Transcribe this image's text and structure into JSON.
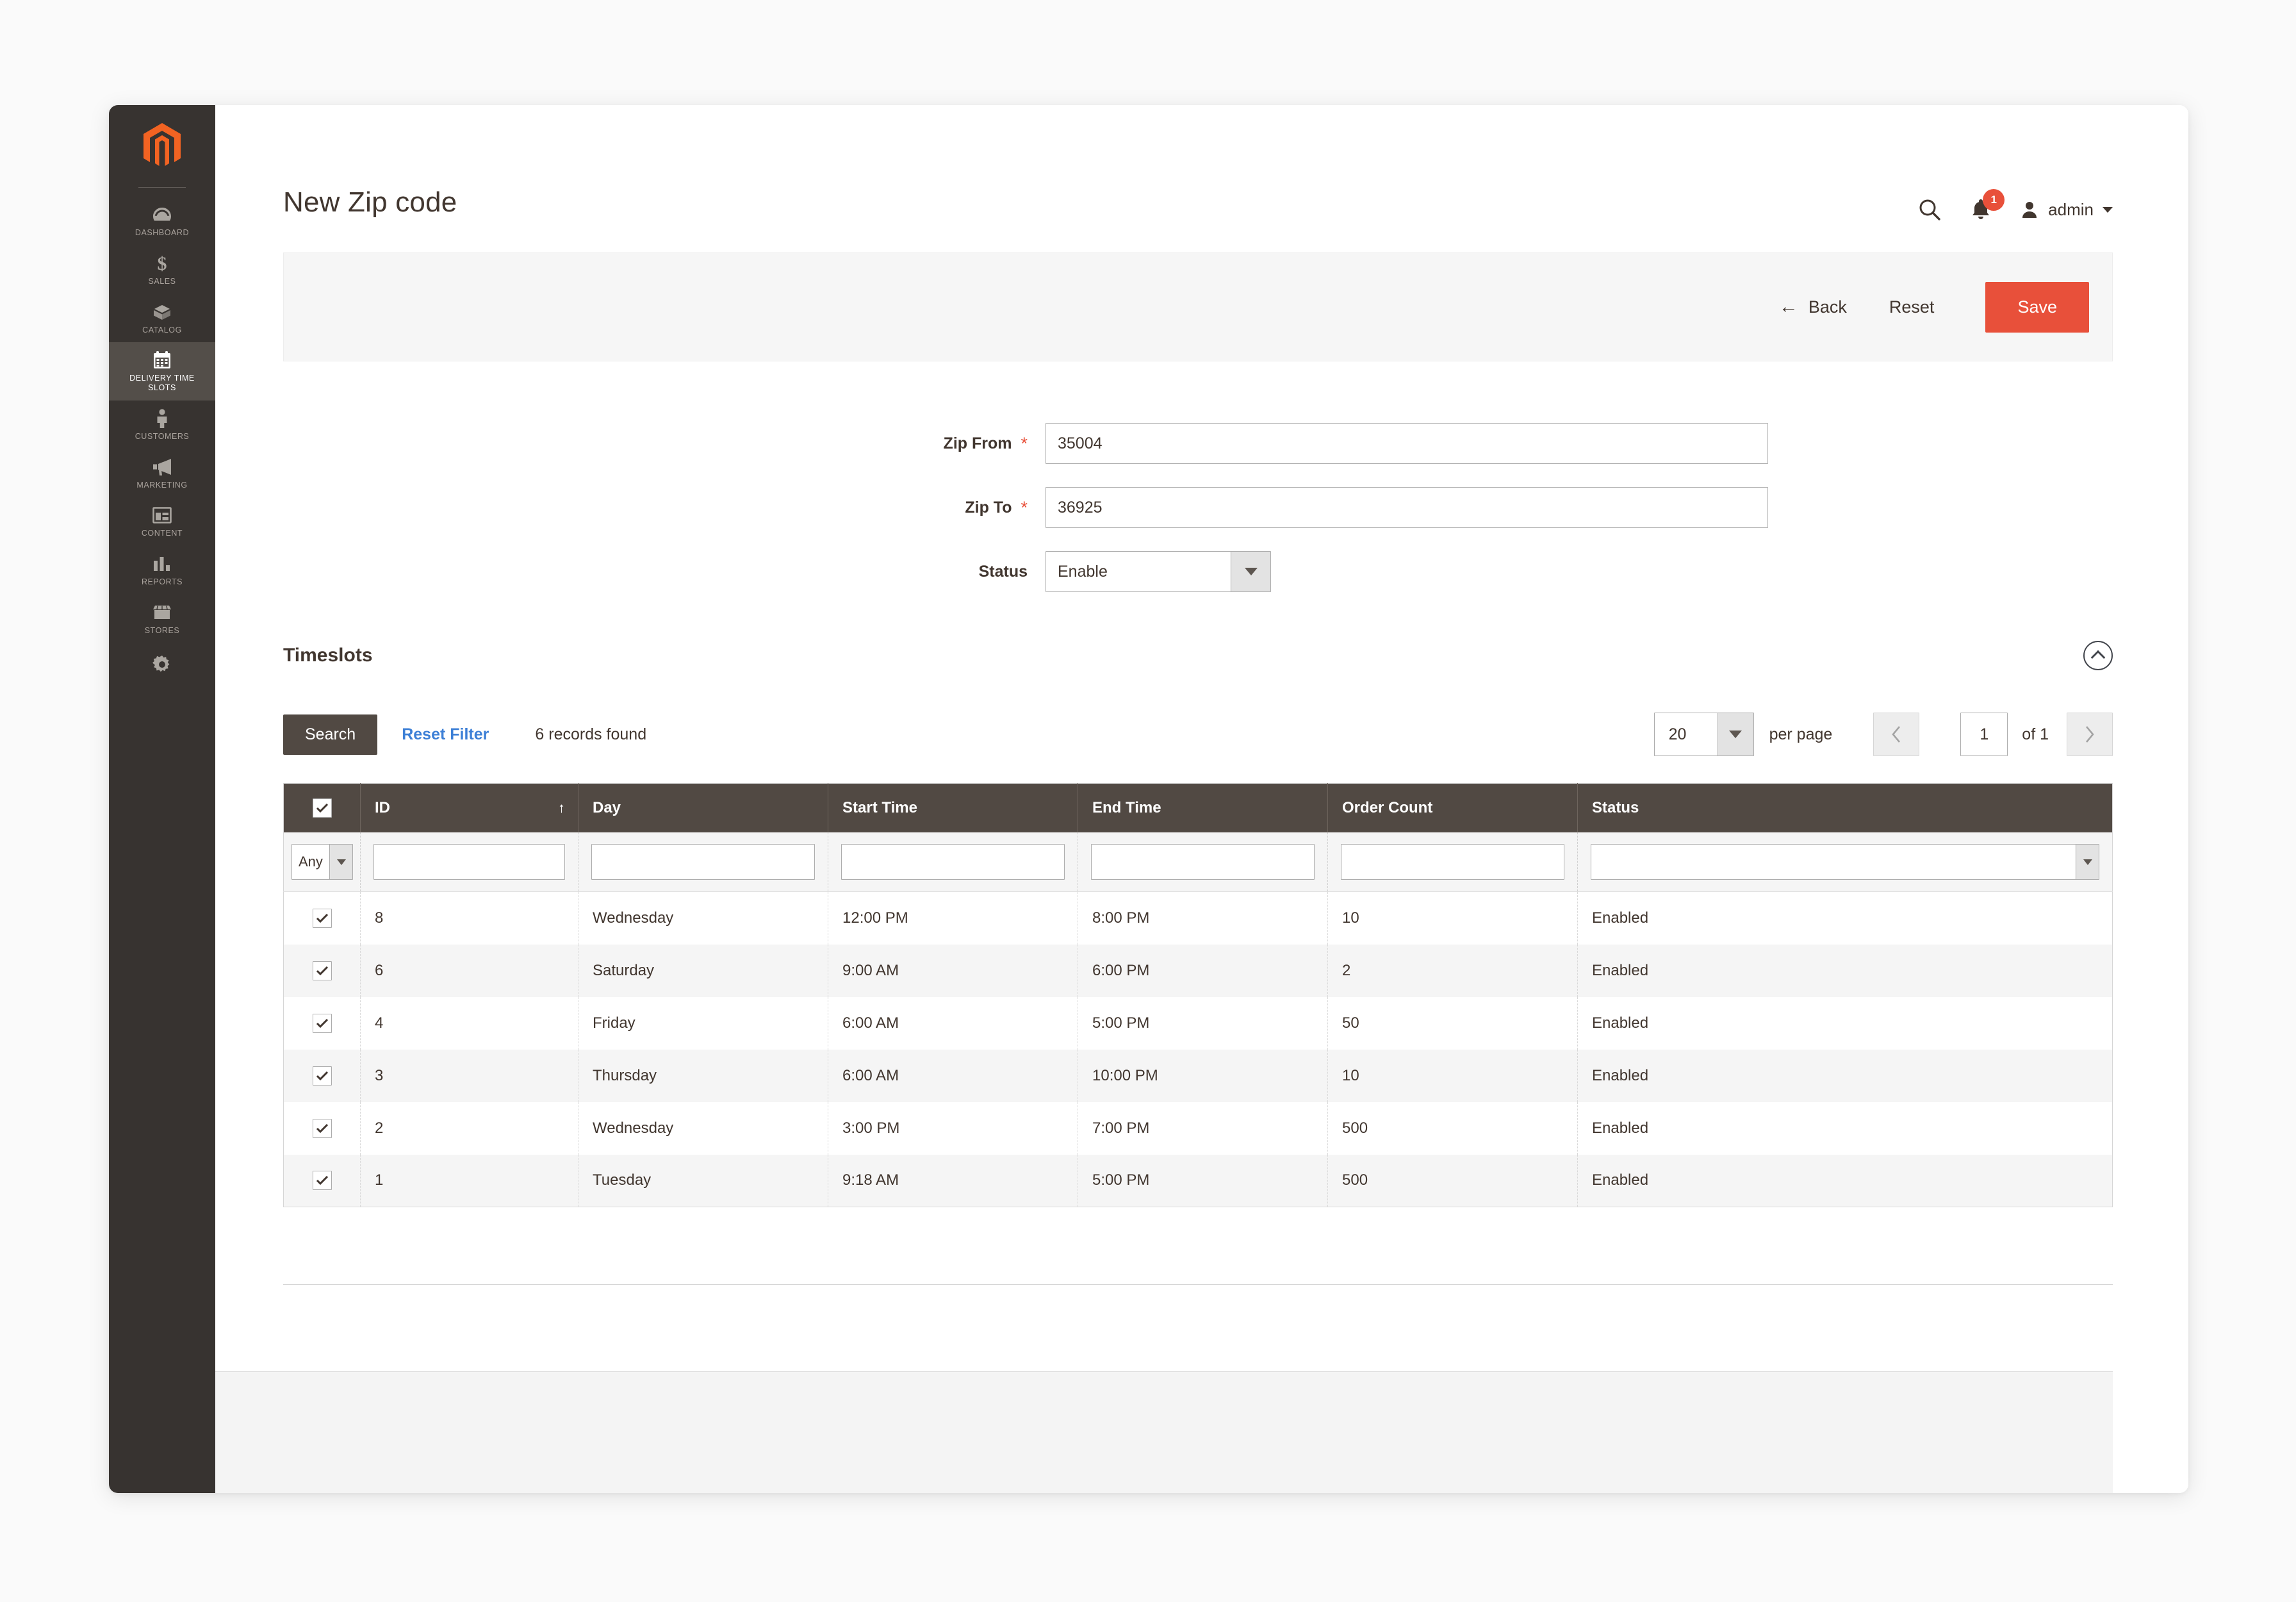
{
  "app": {
    "logo_name": "magento-logo-icon"
  },
  "sidebar": {
    "items": [
      {
        "label": "DASHBOARD",
        "icon": "gauge-icon",
        "active": false
      },
      {
        "label": "SALES",
        "icon": "dollar-icon",
        "active": false
      },
      {
        "label": "CATALOG",
        "icon": "box-icon",
        "active": false
      },
      {
        "label": "DELIVERY TIME SLOTS",
        "icon": "calendar-icon",
        "active": true
      },
      {
        "label": "CUSTOMERS",
        "icon": "person-icon",
        "active": false
      },
      {
        "label": "MARKETING",
        "icon": "megaphone-icon",
        "active": false
      },
      {
        "label": "CONTENT",
        "icon": "layout-icon",
        "active": false
      },
      {
        "label": "REPORTS",
        "icon": "bar-chart-icon",
        "active": false
      },
      {
        "label": "STORES",
        "icon": "storefront-icon",
        "active": false
      },
      {
        "label": "",
        "icon": "gear-icon",
        "active": false
      }
    ]
  },
  "header": {
    "title": "New Zip code",
    "search_icon": "search-icon",
    "notification_icon": "bell-icon",
    "notification_count": "1",
    "avatar_icon": "user-avatar-icon",
    "admin_label": "admin",
    "caret_icon": "chevron-down-icon"
  },
  "action_bar": {
    "back_label": "Back",
    "back_icon": "arrow-left-icon",
    "reset_label": "Reset",
    "save_label": "Save",
    "save_color": "#e8503a"
  },
  "form": {
    "zip_from": {
      "label": "Zip From",
      "required_marker": "*",
      "value": "35004"
    },
    "zip_to": {
      "label": "Zip To",
      "required_marker": "*",
      "value": "36925"
    },
    "status": {
      "label": "Status",
      "value": "Enable"
    }
  },
  "timeslots": {
    "title": "Timeslots",
    "collapse_icon": "chevron-up-circle-icon",
    "toolbar": {
      "search_label": "Search",
      "reset_filter_label": "Reset Filter",
      "records_found": "6 records found",
      "per_page_value": "20",
      "per_page_label": "per page",
      "prev_icon": "chevron-left-icon",
      "next_icon": "chevron-right-icon",
      "page_value": "1",
      "page_of": "of 1"
    },
    "grid": {
      "columns": [
        {
          "key": "check",
          "label": ""
        },
        {
          "key": "id",
          "label": "ID",
          "sorted": true,
          "sort_icon": "sort-asc-icon"
        },
        {
          "key": "day",
          "label": "Day"
        },
        {
          "key": "start_time",
          "label": "Start Time"
        },
        {
          "key": "end_time",
          "label": "End Time"
        },
        {
          "key": "order_count",
          "label": "Order Count"
        },
        {
          "key": "status",
          "label": "Status"
        }
      ],
      "filters": {
        "check_select": "Any",
        "id": "",
        "day": "",
        "start_time": "",
        "end_time": "",
        "order_count": "",
        "status": ""
      },
      "rows": [
        {
          "id": "8",
          "day": "Wednesday",
          "start_time": "12:00 PM",
          "end_time": "8:00 PM",
          "order_count": "10",
          "status": "Enabled",
          "checked": true
        },
        {
          "id": "6",
          "day": "Saturday",
          "start_time": "9:00 AM",
          "end_time": "6:00 PM",
          "order_count": "2",
          "status": "Enabled",
          "checked": true
        },
        {
          "id": "4",
          "day": "Friday",
          "start_time": "6:00 AM",
          "end_time": "5:00 PM",
          "order_count": "50",
          "status": "Enabled",
          "checked": true
        },
        {
          "id": "3",
          "day": "Thursday",
          "start_time": "6:00 AM",
          "end_time": "10:00 PM",
          "order_count": "10",
          "status": "Enabled",
          "checked": true
        },
        {
          "id": "2",
          "day": "Wednesday",
          "start_time": "3:00 PM",
          "end_time": "7:00 PM",
          "order_count": "500",
          "status": "Enabled",
          "checked": true
        },
        {
          "id": "1",
          "day": "Tuesday",
          "start_time": "9:18 AM",
          "end_time": "5:00 PM",
          "order_count": "500",
          "status": "Enabled",
          "checked": true
        }
      ]
    }
  },
  "colors": {
    "sidebar_bg": "#373330",
    "sidebar_active_bg": "#534e49",
    "accent_orange": "#e8503a",
    "grid_header_bg": "#514943",
    "link_blue": "#3c7fd6"
  }
}
